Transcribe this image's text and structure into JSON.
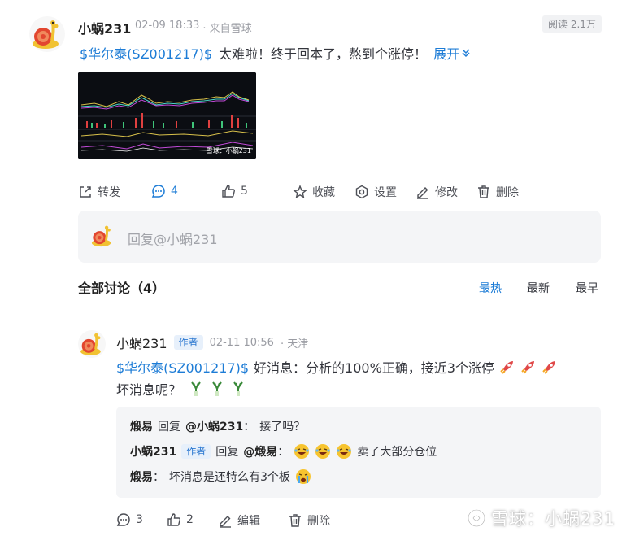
{
  "post": {
    "author": "小蜗231",
    "time": "02-09 18:33",
    "source": "· 来自雪球",
    "views": "阅读 2.1万",
    "stock_tag": "$华尔泰(SZ001217)$",
    "text": "太难啦！终于回本了，熬到个涨停！",
    "expand": "展开",
    "image_caption": "雪球：小蜗231",
    "actions": {
      "repost": "转发",
      "comments": "4",
      "likes": "5",
      "favorite": "收藏",
      "settings": "设置",
      "edit": "修改",
      "delete": "删除"
    }
  },
  "reply_input": {
    "placeholder": "回复@小蜗231"
  },
  "discussion": {
    "title": "全部讨论（4）",
    "sort": [
      "最热",
      "最新",
      "最早"
    ],
    "active_sort": "最热"
  },
  "comment": {
    "author": "小蜗231",
    "badge": "作者",
    "time": "02-11 10:56",
    "location": "· 天津",
    "stock_tag": "$华尔泰(SZ001217)$",
    "text": "好消息：分析的100%正确，接近3个涨停",
    "text2": "坏消息呢？",
    "replies": [
      {
        "author": "煅易",
        "mid": "回复",
        "to": "@小蜗231",
        "sep": "：",
        "text": "接了吗？"
      },
      {
        "author": "小蜗231",
        "badge": "作者",
        "mid": "回复",
        "to": "@煅易",
        "sep": "：",
        "text": "卖了大部分仓位"
      },
      {
        "author": "煅易",
        "sep": "：",
        "text": "坏消息是还特么有3个板"
      }
    ],
    "actions": {
      "comments": "3",
      "likes": "2",
      "edit": "编辑",
      "delete": "删除"
    }
  },
  "watermark": "雪球：小蜗231",
  "colors": {
    "link": "#1d7cd6",
    "badge_bg": "#e7f0fb",
    "text": "#33353c"
  }
}
